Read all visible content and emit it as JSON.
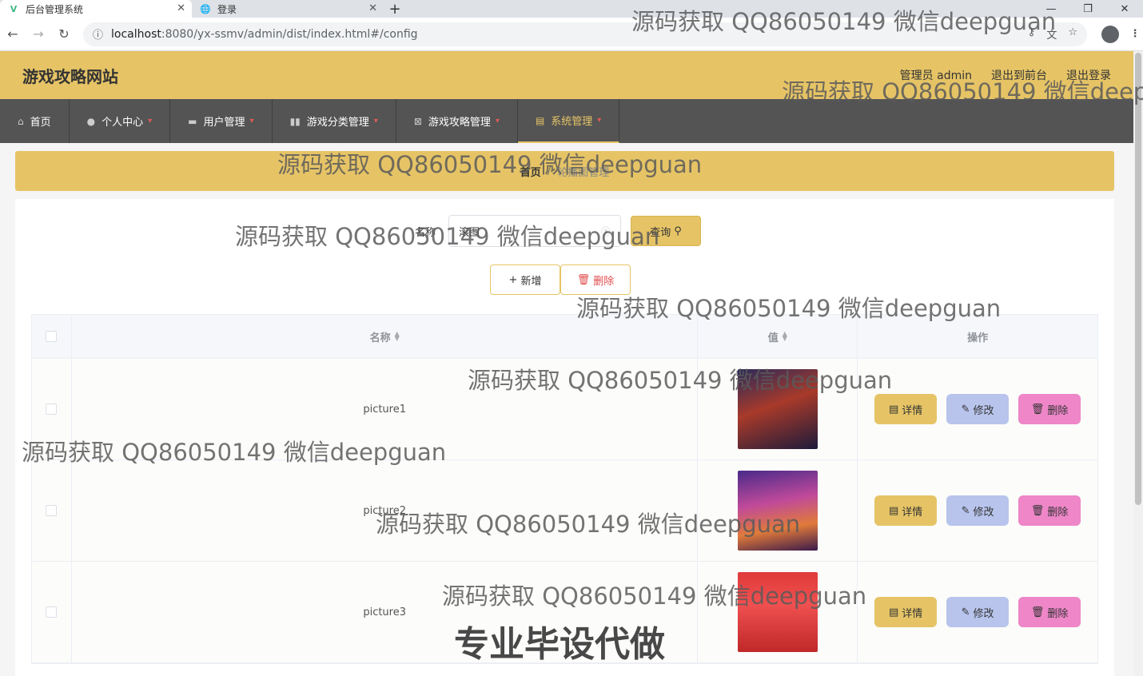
{
  "browser": {
    "tabs": [
      {
        "title": "后台管理系统",
        "active": true
      },
      {
        "title": "登录",
        "active": false
      }
    ],
    "url_host": "localhost",
    "url_rest": ":8080/yx-ssmv/admin/dist/index.html#/config"
  },
  "header": {
    "title": "游戏攻略网站",
    "user": "管理员 admin",
    "to_front": "退出到前台",
    "logout": "退出登录"
  },
  "nav": [
    {
      "label": "首页",
      "icon": "home-icon"
    },
    {
      "label": "个人中心",
      "icon": "user-icon"
    },
    {
      "label": "用户管理",
      "icon": "briefcase-icon"
    },
    {
      "label": "游戏分类管理",
      "icon": "books-icon"
    },
    {
      "label": "游戏攻略管理",
      "icon": "calendar-x-icon"
    },
    {
      "label": "系统管理",
      "icon": "clipboard-icon",
      "active": true
    }
  ],
  "breadcrumb": {
    "home": "首页",
    "sep": "/",
    "current": "轮播图管理"
  },
  "search": {
    "label": "名称",
    "value": "滚图",
    "button": "查询"
  },
  "actions": {
    "add": "新增",
    "delete": "删除"
  },
  "table": {
    "columns": [
      "名称",
      "值",
      "操作"
    ],
    "rows": [
      {
        "name": "picture1"
      },
      {
        "name": "picture2"
      },
      {
        "name": "picture3"
      }
    ],
    "buttons": {
      "detail": "详情",
      "edit": "修改",
      "delete": "删除"
    }
  },
  "watermarks": {
    "contact": "源码获取 QQ86050149 微信deepguan",
    "slogan": "专业毕设代做"
  },
  "colors": {
    "accent": "#e6c466",
    "nav_bg": "#545454",
    "edit": "#b8c4ec",
    "delete": "#ee86c8"
  }
}
